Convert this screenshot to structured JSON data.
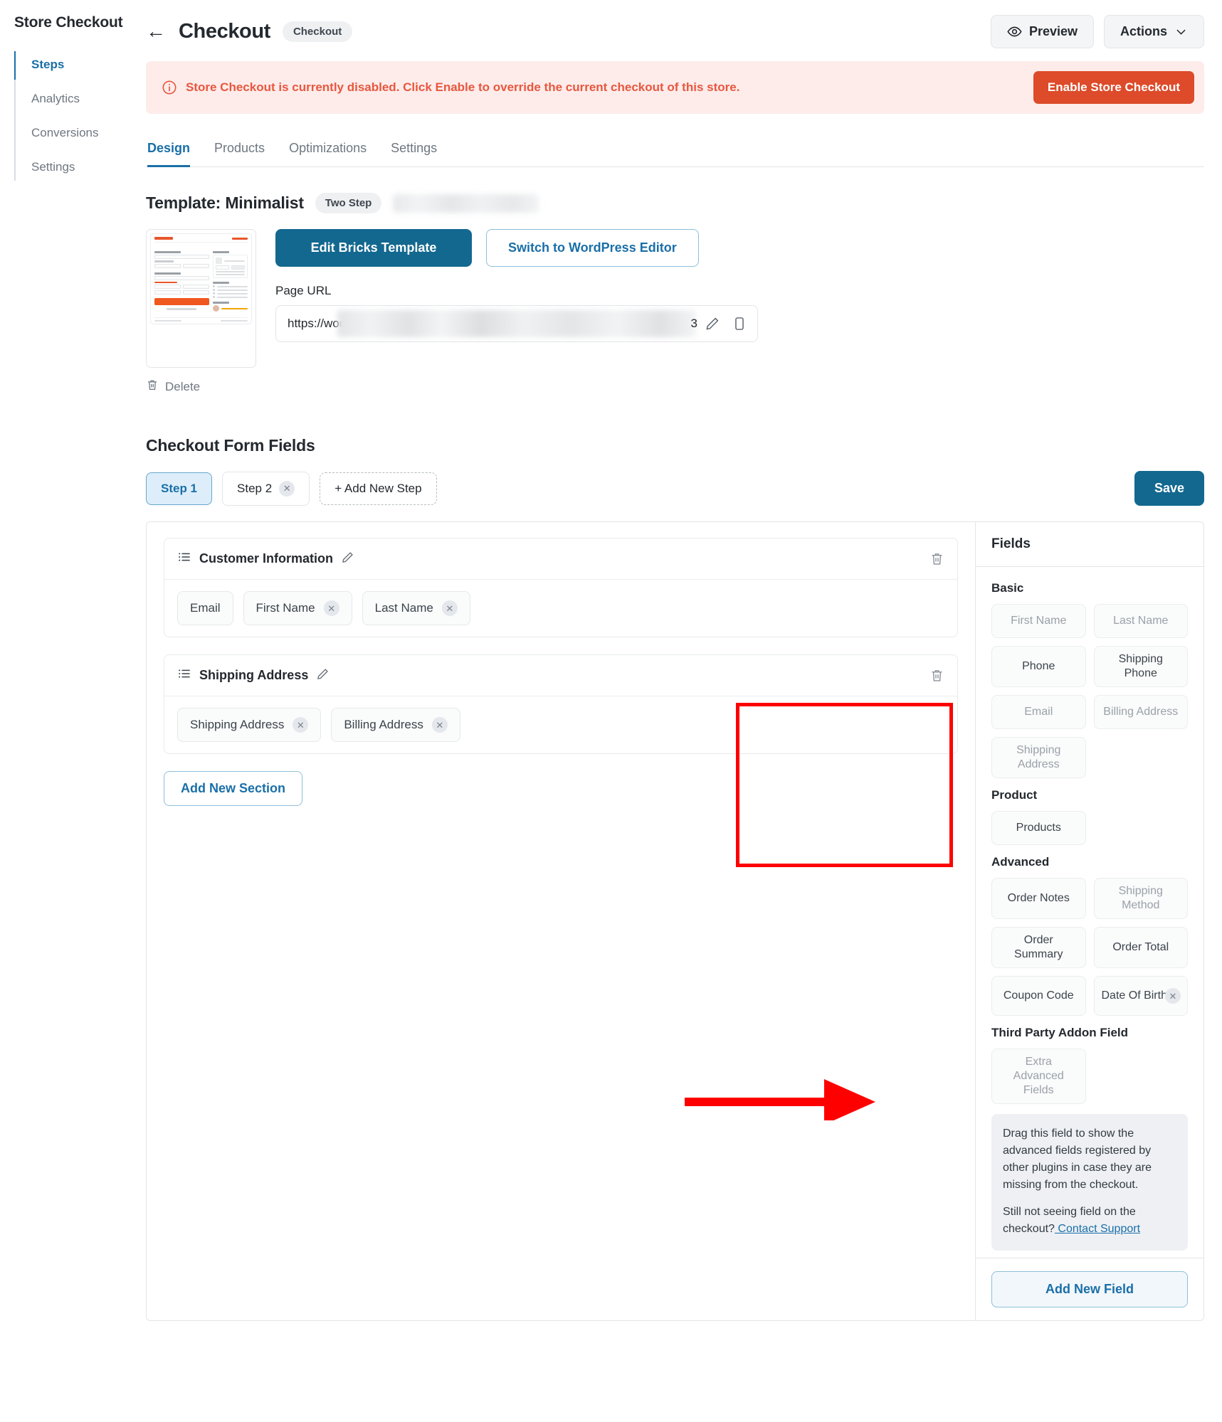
{
  "sidebar": {
    "title": "Store Checkout",
    "items": [
      {
        "label": "Steps",
        "active": true
      },
      {
        "label": "Analytics",
        "active": false
      },
      {
        "label": "Conversions",
        "active": false
      },
      {
        "label": "Settings",
        "active": false
      }
    ]
  },
  "header": {
    "back_icon": "arrow-left-icon",
    "title": "Checkout",
    "badge": "Checkout",
    "preview_label": "Preview",
    "actions_label": "Actions",
    "preview_icon": "eye-icon",
    "actions_icon": "chevron-down-icon"
  },
  "alert": {
    "icon": "info-circle-icon",
    "message": "Store Checkout is currently disabled. Click Enable to override the current checkout of this store.",
    "button_label": "Enable Store Checkout",
    "bg_color": "#fdecea",
    "text_color": "#e8573f",
    "button_color": "#dd4b2a"
  },
  "tabs": [
    {
      "label": "Design",
      "active": true
    },
    {
      "label": "Products",
      "active": false
    },
    {
      "label": "Optimizations",
      "active": false
    },
    {
      "label": "Settings",
      "active": false
    }
  ],
  "template": {
    "title": "Template: Minimalist",
    "badge": "Two Step",
    "redacted_label": "",
    "edit_button": "Edit Bricks Template",
    "switch_button": "Switch to WordPress Editor",
    "url_label": "Page URL",
    "url_value": "https://wooc",
    "url_tail": "3",
    "edit_icon": "pencil-icon",
    "copy_icon": "copy-icon",
    "delete_label": "Delete",
    "delete_icon": "trash-icon",
    "thumbnail_name": "template-preview-thumbnail"
  },
  "form_fields": {
    "heading": "Checkout Form Fields",
    "steps": [
      {
        "label": "Step 1",
        "active": true,
        "closable": false
      },
      {
        "label": "Step 2",
        "active": false,
        "closable": true
      }
    ],
    "add_step_label": "+ Add New Step",
    "save_label": "Save",
    "add_section_label": "Add New Section",
    "sections": [
      {
        "name": "Customer Information",
        "list_icon": "list-icon",
        "edit_icon": "pencil-icon",
        "delete_icon": "trash-icon",
        "fields": [
          {
            "label": "Email",
            "closable": false
          },
          {
            "label": "First Name",
            "closable": true
          },
          {
            "label": "Last Name",
            "closable": true
          }
        ]
      },
      {
        "name": "Shipping Address",
        "list_icon": "list-icon",
        "edit_icon": "pencil-icon",
        "delete_icon": "trash-icon",
        "fields": [
          {
            "label": "Shipping Address",
            "closable": true
          },
          {
            "label": "Billing Address",
            "closable": true
          }
        ]
      }
    ]
  },
  "fields_panel": {
    "title": "Fields",
    "groups": [
      {
        "title": "Basic",
        "tiles": [
          {
            "label": "First Name",
            "disabled": true,
            "closable": false
          },
          {
            "label": "Last Name",
            "disabled": true,
            "closable": false
          },
          {
            "label": "Phone",
            "disabled": false,
            "closable": false
          },
          {
            "label": "Shipping Phone",
            "disabled": false,
            "closable": false
          },
          {
            "label": "Email",
            "disabled": true,
            "closable": false
          },
          {
            "label": "Billing Address",
            "disabled": true,
            "closable": false
          },
          {
            "label": "Shipping Address",
            "disabled": true,
            "closable": false
          }
        ]
      },
      {
        "title": "Product",
        "tiles": [
          {
            "label": "Products",
            "disabled": false,
            "closable": false
          }
        ]
      },
      {
        "title": "Advanced",
        "highlighted": true,
        "tiles": [
          {
            "label": "Order Notes",
            "disabled": false,
            "closable": false
          },
          {
            "label": "Shipping Method",
            "disabled": true,
            "closable": false
          },
          {
            "label": "Order Summary",
            "disabled": false,
            "closable": false
          },
          {
            "label": "Order Total",
            "disabled": false,
            "closable": false
          },
          {
            "label": "Coupon Code",
            "disabled": false,
            "closable": false
          },
          {
            "label": "Date Of Birth",
            "disabled": false,
            "closable": true
          }
        ]
      },
      {
        "title": "Third Party Addon Field",
        "tiles": [
          {
            "label": "Extra Advanced Fields",
            "disabled": true,
            "closable": false
          }
        ]
      }
    ],
    "note_line1": "Drag this field to show the advanced fields registered by other plugins in case they are missing from the checkout.",
    "note_line2_prefix": "Still not seeing field on the checkout?",
    "note_link": " Contact Support",
    "add_field_label": "Add New Field"
  },
  "annotations": {
    "highlight_color": "#ff0000",
    "arrow_color": "#ff0000",
    "highlight_target": "advanced-fields-group",
    "arrow_target": "add-new-field-button"
  }
}
